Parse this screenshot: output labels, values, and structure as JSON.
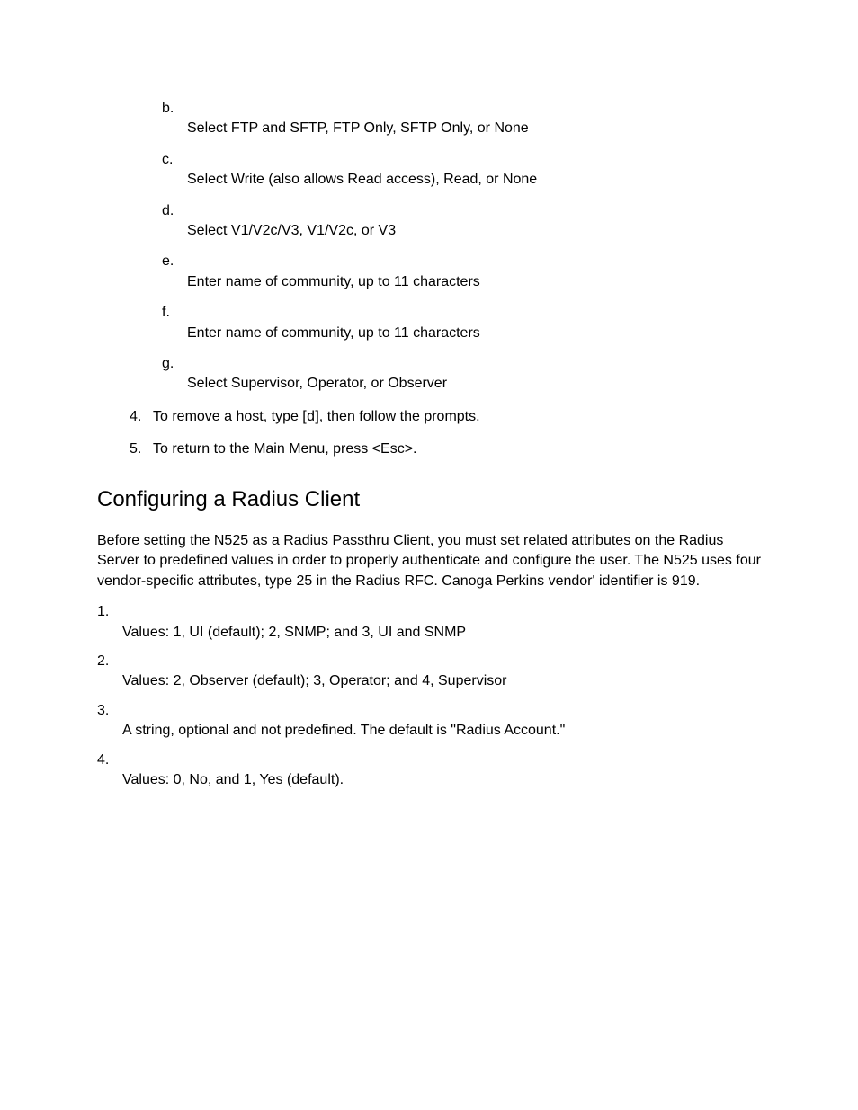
{
  "subList": [
    {
      "marker": "b.",
      "text": "Select FTP and SFTP, FTP Only, SFTP Only, or None"
    },
    {
      "marker": "c.",
      "text": "Select Write (also allows Read access), Read, or None"
    },
    {
      "marker": "d.",
      "text": "Select V1/V2c/V3, V1/V2c, or V3"
    },
    {
      "marker": "e.",
      "text": "Enter name of community, up to 11 characters"
    },
    {
      "marker": "f.",
      "text": "Enter name of community, up to 11 characters"
    },
    {
      "marker": "g.",
      "text": "Select Supervisor, Operator, or Observer"
    }
  ],
  "numList": [
    {
      "marker": "4.",
      "pre": "To remove a host, type [",
      "mono": "d",
      "post": "], then follow the prompts."
    },
    {
      "marker": "5.",
      "pre": "To return to the Main Menu, press <Esc>.",
      "mono": "",
      "post": ""
    }
  ],
  "heading": "Configuring a Radius Client",
  "para": "Before setting the N525 as a Radius Passthru Client, you must set related attributes on the Radius Server to predefined values in order to properly authenticate and configure the user. The N525 uses four vendor-specific attributes, type 25 in the Radius RFC. Canoga Perkins vendor' identifier is 919.",
  "attrList": [
    {
      "marker": "1.",
      "text": "Values: 1, UI (default); 2, SNMP; and 3, UI and SNMP"
    },
    {
      "marker": "2.",
      "text": "Values: 2, Observer (default); 3, Operator; and 4, Supervisor"
    },
    {
      "marker": "3.",
      "text": "A string, optional and not predefined. The default is \"Radius Account.\""
    },
    {
      "marker": "4.",
      "text": "Values: 0, No, and 1, Yes (default)."
    }
  ]
}
